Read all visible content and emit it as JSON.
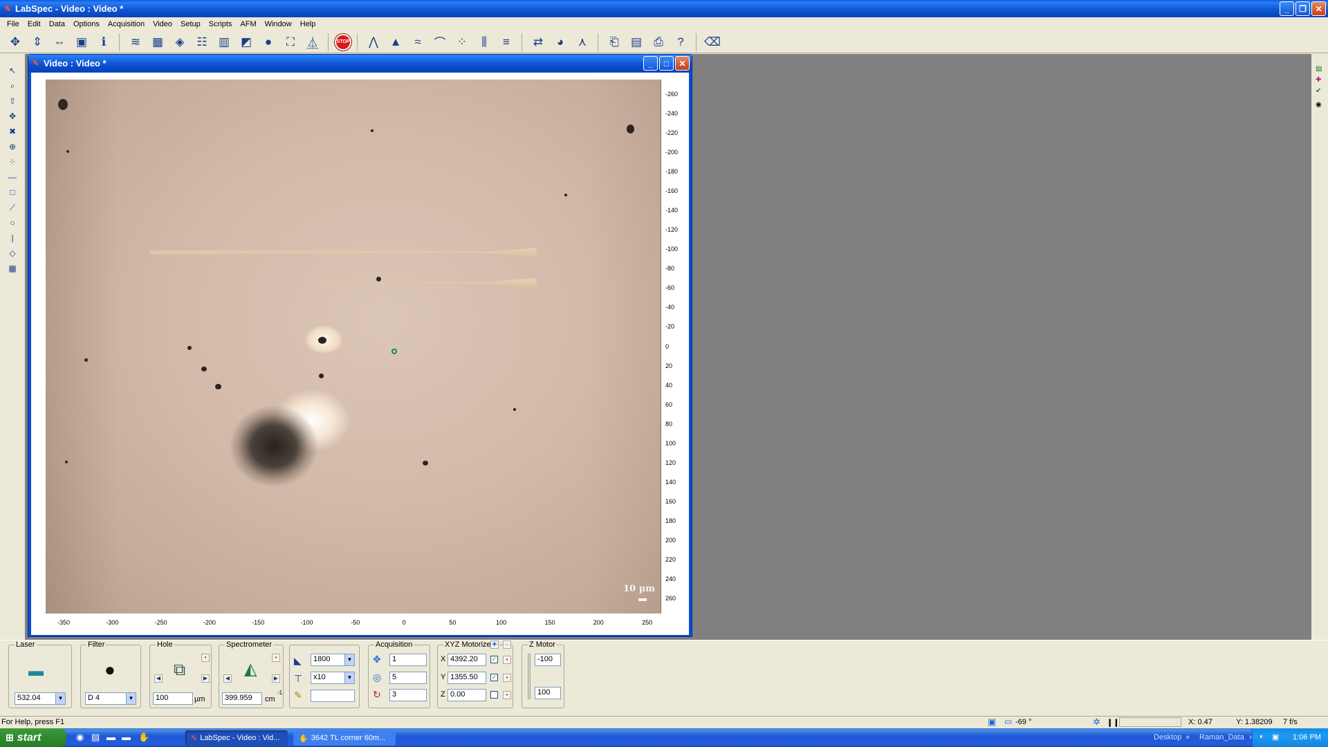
{
  "window": {
    "title": "LabSpec - Video : Video *"
  },
  "menu": [
    "File",
    "Edit",
    "Data",
    "Options",
    "Acquisition",
    "Video",
    "Setup",
    "Scripts",
    "AFM",
    "Window",
    "Help"
  ],
  "toolbar": {
    "stop_label": "STOP"
  },
  "video_window": {
    "title": "Video : Video *",
    "scale_bar_label": "10 µm",
    "y_ticks": [
      "-260",
      "-240",
      "-220",
      "-200",
      "-180",
      "-160",
      "-140",
      "-120",
      "-100",
      "-80",
      "-60",
      "-40",
      "-20",
      "0",
      "20",
      "40",
      "60",
      "80",
      "100",
      "120",
      "140",
      "160",
      "180",
      "200",
      "220",
      "240",
      "260"
    ],
    "x_ticks": [
      "-350",
      "-300",
      "-250",
      "-200",
      "-150",
      "-100",
      "-50",
      "0",
      "50",
      "100",
      "150",
      "200",
      "250"
    ]
  },
  "controls": {
    "laser": {
      "label": "Laser",
      "value": "532.04"
    },
    "filter": {
      "label": "Filter",
      "value": "D 4"
    },
    "hole": {
      "label": "Hole",
      "value": "100",
      "unit": "µm"
    },
    "spectrometer": {
      "label": "Spectrometer",
      "value": "399.959",
      "unit": "cm",
      "unit_sup": "-1"
    },
    "grating": {
      "value": "1800"
    },
    "objective": {
      "value": "x10"
    },
    "extra": {
      "value": ""
    },
    "acquisition": {
      "label": "Acquisition",
      "time": "1",
      "accum": "5",
      "cycles": "3"
    },
    "xyz": {
      "label": "XYZ Motorized",
      "x_label": "X",
      "x": "4392.20",
      "y_label": "Y",
      "y": "1355.50",
      "z_label": "Z",
      "z": "0.00"
    },
    "zmotor": {
      "label": "Z Motor",
      "top": "-100",
      "bottom": "100"
    }
  },
  "status": {
    "help": "For Help, press F1",
    "angle": "-69 °",
    "x": "X: 0.47",
    "y": "Y: 1.38209",
    "fps": "7 f/s"
  },
  "taskbar": {
    "start_label": "start",
    "tasks": [
      "LabSpec - Video : Vid...",
      "3642 TL corner 60m..."
    ],
    "links": [
      "Desktop",
      "Raman_Data"
    ],
    "clock": "1:06 PM"
  }
}
